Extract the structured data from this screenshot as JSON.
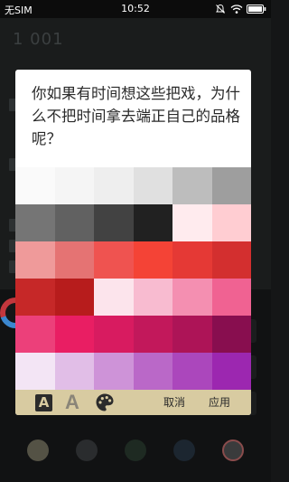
{
  "status_bar": {
    "carrier": "无SIM",
    "time": "10:52",
    "icons": [
      "mute-icon",
      "wifi-icon",
      "battery-icon"
    ]
  },
  "background": {
    "counter": "1 001"
  },
  "dialog": {
    "quote": "你如果有时间想这些把戏，为什么不把时间拿去端正自己的品格呢？",
    "palette": [
      "#fafafa",
      "#f5f5f5",
      "#eeeeee",
      "#e0e0e0",
      "#bdbdbd",
      "#9e9e9e",
      "#757575",
      "#616161",
      "#424242",
      "#212121",
      "#ffebee",
      "#ffcdd2",
      "#ef9a9a",
      "#e57373",
      "#ef5350",
      "#f44336",
      "#e53935",
      "#d32f2f",
      "#c62828",
      "#b71c1c",
      "#fce4ec",
      "#f8bbd0",
      "#f48fb1",
      "#f06292",
      "#ec407a",
      "#e91e63",
      "#d81b60",
      "#c2185b",
      "#ad1457",
      "#880e4f",
      "#f3e5f5",
      "#e1bee7",
      "#ce93d8",
      "#ba68c8",
      "#ab47bc",
      "#9c27b0"
    ],
    "toolbar": {
      "bold_letter": "A",
      "plain_letter": "A",
      "palette_icon": "palette-icon",
      "cancel_label": "取消",
      "apply_label": "应用",
      "background_color": "#d8cba1"
    }
  }
}
